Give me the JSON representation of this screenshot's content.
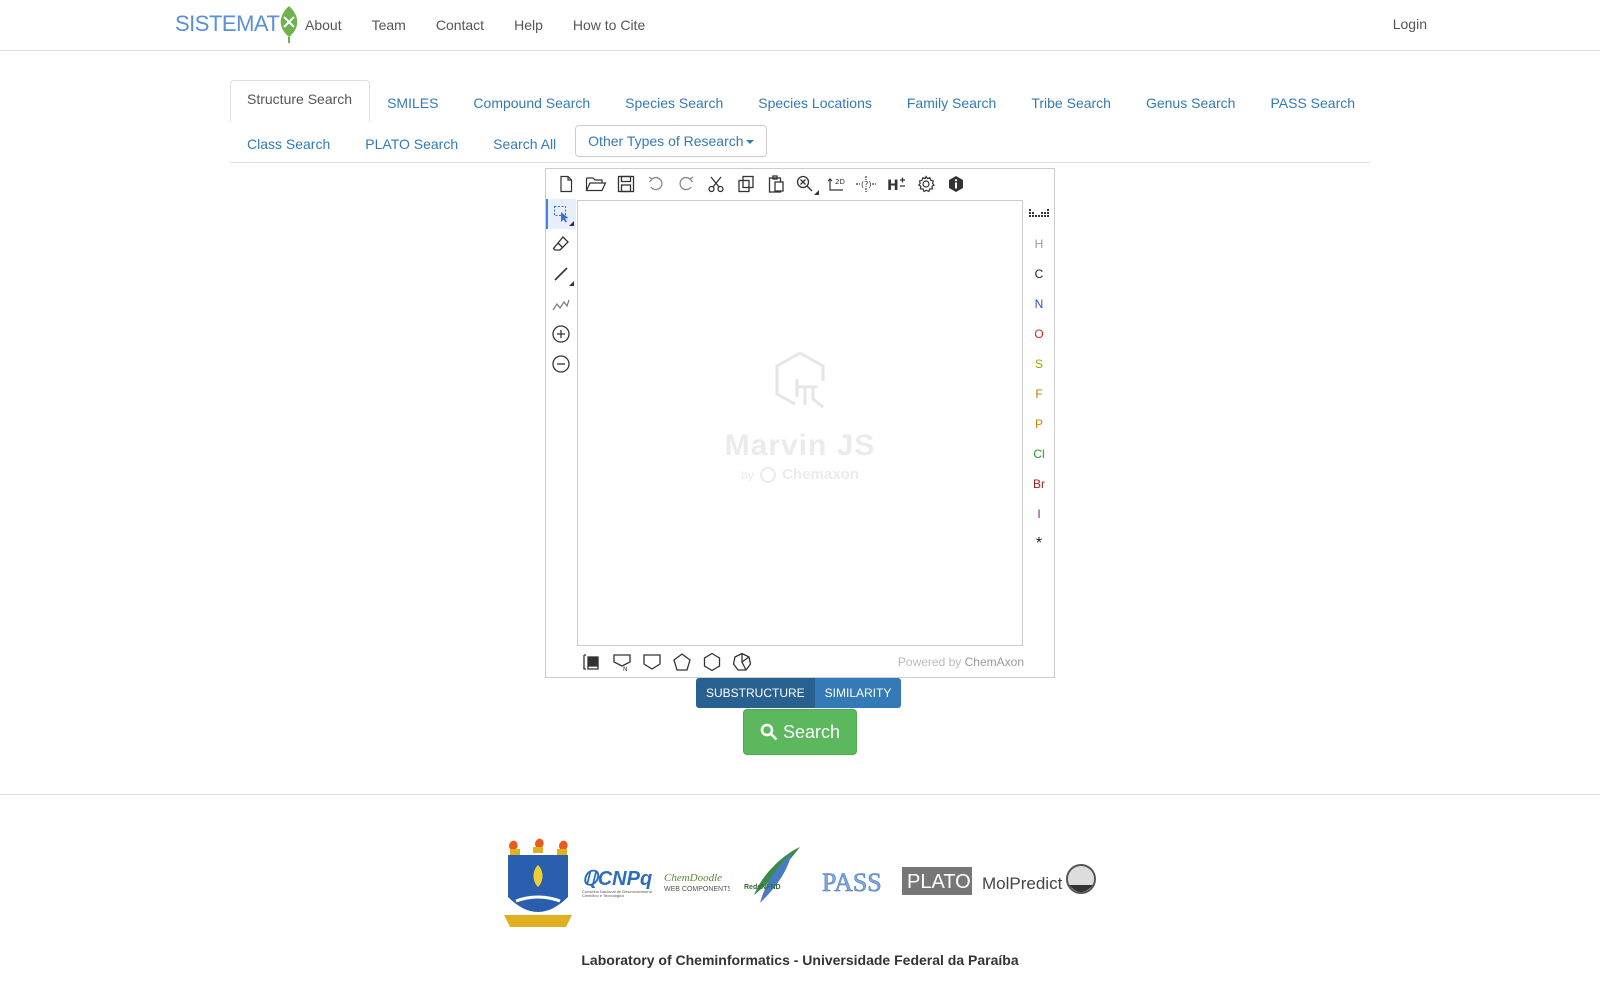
{
  "brand": {
    "name": "SISTEMAT"
  },
  "nav": {
    "links": [
      "About",
      "Team",
      "Contact",
      "Help",
      "How to Cite"
    ],
    "login": "Login"
  },
  "tabs": {
    "row1": [
      "Structure Search",
      "SMILES",
      "Compound Search",
      "Species Search",
      "Species Locations",
      "Family Search",
      "Tribe Search",
      "Genus Search",
      "PASS Search"
    ],
    "row2": [
      "Class Search",
      "PLATO Search",
      "Search All"
    ],
    "dropdown": "Other Types of Research",
    "active": "Structure Search"
  },
  "editor": {
    "watermark_title": "Marvin JS",
    "watermark_by": "by",
    "watermark_company": "Chemaxon",
    "powered_prefix": "Powered by",
    "powered_brand": "ChemAxon",
    "elements": [
      {
        "symbol": "H",
        "color": "#999999"
      },
      {
        "symbol": "C",
        "color": "#222222"
      },
      {
        "symbol": "N",
        "color": "#3050cc"
      },
      {
        "symbol": "O",
        "color": "#e02020"
      },
      {
        "symbol": "S",
        "color": "#a0a000"
      },
      {
        "symbol": "F",
        "color": "#c08000"
      },
      {
        "symbol": "P",
        "color": "#e08000"
      },
      {
        "symbol": "Cl",
        "color": "#20a020"
      },
      {
        "symbol": "Br",
        "color": "#a02020"
      },
      {
        "symbol": "I",
        "color": "#9020a0"
      },
      {
        "symbol": "*",
        "color": "#222222"
      }
    ]
  },
  "search_mode": {
    "options": [
      "SUBSTRUCTURE",
      "SIMILARITY"
    ],
    "selected": "SUBSTRUCTURE"
  },
  "search_button": "Search",
  "footer": {
    "logos": [
      "UFPB",
      "CNPq",
      "ChemDoodle Web Components",
      "RedeNFND",
      "PASS",
      "PLATO",
      "MolPredictX"
    ],
    "text": "Laboratory of Cheminformatics - Universidade Federal da Paraíba"
  }
}
